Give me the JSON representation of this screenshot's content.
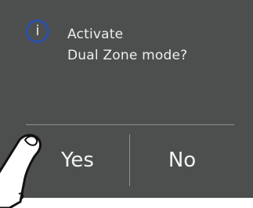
{
  "dialog": {
    "icon": "info-icon",
    "icon_glyph": "i",
    "message_lines": [
      "Activate",
      "Dual Zone mode?"
    ],
    "buttons": {
      "yes_label": "Yes",
      "no_label": "No"
    }
  },
  "overlay": {
    "icon": "finger-pointer-icon"
  },
  "colors": {
    "dialog_background": "#4d4f4e",
    "icon_ring": "#2b50a8",
    "text": "#eeeeee",
    "divider": "#8e8f8f"
  }
}
